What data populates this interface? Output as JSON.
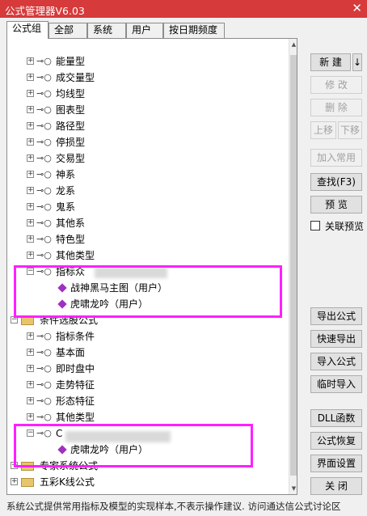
{
  "window": {
    "title": "公式管理器V6.03",
    "close": "✕"
  },
  "tabs": [
    "公式组",
    "全部",
    "系统",
    "用户",
    "按日期频度"
  ],
  "tree": [
    {
      "type": "group",
      "expander": "+",
      "label": "能量型"
    },
    {
      "type": "group",
      "expander": "+",
      "label": "成交量型"
    },
    {
      "type": "group",
      "expander": "+",
      "label": "均线型"
    },
    {
      "type": "group",
      "expander": "+",
      "label": "图表型"
    },
    {
      "type": "group",
      "expander": "+",
      "label": "路径型"
    },
    {
      "type": "group",
      "expander": "+",
      "label": "停损型"
    },
    {
      "type": "group",
      "expander": "+",
      "label": "交易型"
    },
    {
      "type": "group",
      "expander": "+",
      "label": "神系"
    },
    {
      "type": "group",
      "expander": "+",
      "label": "龙系"
    },
    {
      "type": "group",
      "expander": "+",
      "label": "鬼系"
    },
    {
      "type": "group",
      "expander": "+",
      "label": "其他系"
    },
    {
      "type": "group",
      "expander": "+",
      "label": "特色型"
    },
    {
      "type": "group",
      "expander": "+",
      "label": "其他类型"
    },
    {
      "type": "group",
      "expander": "−",
      "label": "指标众",
      "blurred": true
    },
    {
      "type": "formula",
      "label": "战神黑马主图（用户）"
    },
    {
      "type": "formula",
      "label": "虎啸龙吟（用户）"
    },
    {
      "type": "folder",
      "expander": "−",
      "label": "条件选股公式"
    },
    {
      "type": "group",
      "expander": "+",
      "label": "指标条件"
    },
    {
      "type": "group",
      "expander": "+",
      "label": "基本面"
    },
    {
      "type": "group",
      "expander": "+",
      "label": "即时盘中"
    },
    {
      "type": "group",
      "expander": "+",
      "label": "走势特征"
    },
    {
      "type": "group",
      "expander": "+",
      "label": "形态特征"
    },
    {
      "type": "group",
      "expander": "+",
      "label": "其他类型"
    },
    {
      "type": "group",
      "expander": "−",
      "label": "C",
      "blurred": true
    },
    {
      "type": "formula",
      "label": "虎啸龙吟（用户）"
    },
    {
      "type": "folder",
      "expander": "+",
      "label": "专家系统公式"
    },
    {
      "type": "folder",
      "expander": "+",
      "label": "五彩K线公式"
    }
  ],
  "buttons": {
    "new": "新 建",
    "new_arrow": "↓",
    "modify": "修 改",
    "delete": "删 除",
    "move_up": "上移",
    "move_down": "下移",
    "add_common": "加入常用",
    "find": "查找(F3)",
    "preview": "预 览",
    "export": "导出公式",
    "quick_export": "快速导出",
    "import": "导入公式",
    "temp_import": "临时导入",
    "dll": "DLL函数",
    "restore": "公式恢复",
    "ui_settings": "界面设置",
    "close": "关 闭"
  },
  "checkbox": {
    "label": "关联预览",
    "checked": false
  },
  "status": "系统公式提供常用指标及模型的实现样本,不表示操作建议.  访问通达信公式讨论区",
  "colors": {
    "titlebar": "#d63a3a",
    "highlight": "#ff1fff",
    "formula_icon": "#a030c0"
  }
}
